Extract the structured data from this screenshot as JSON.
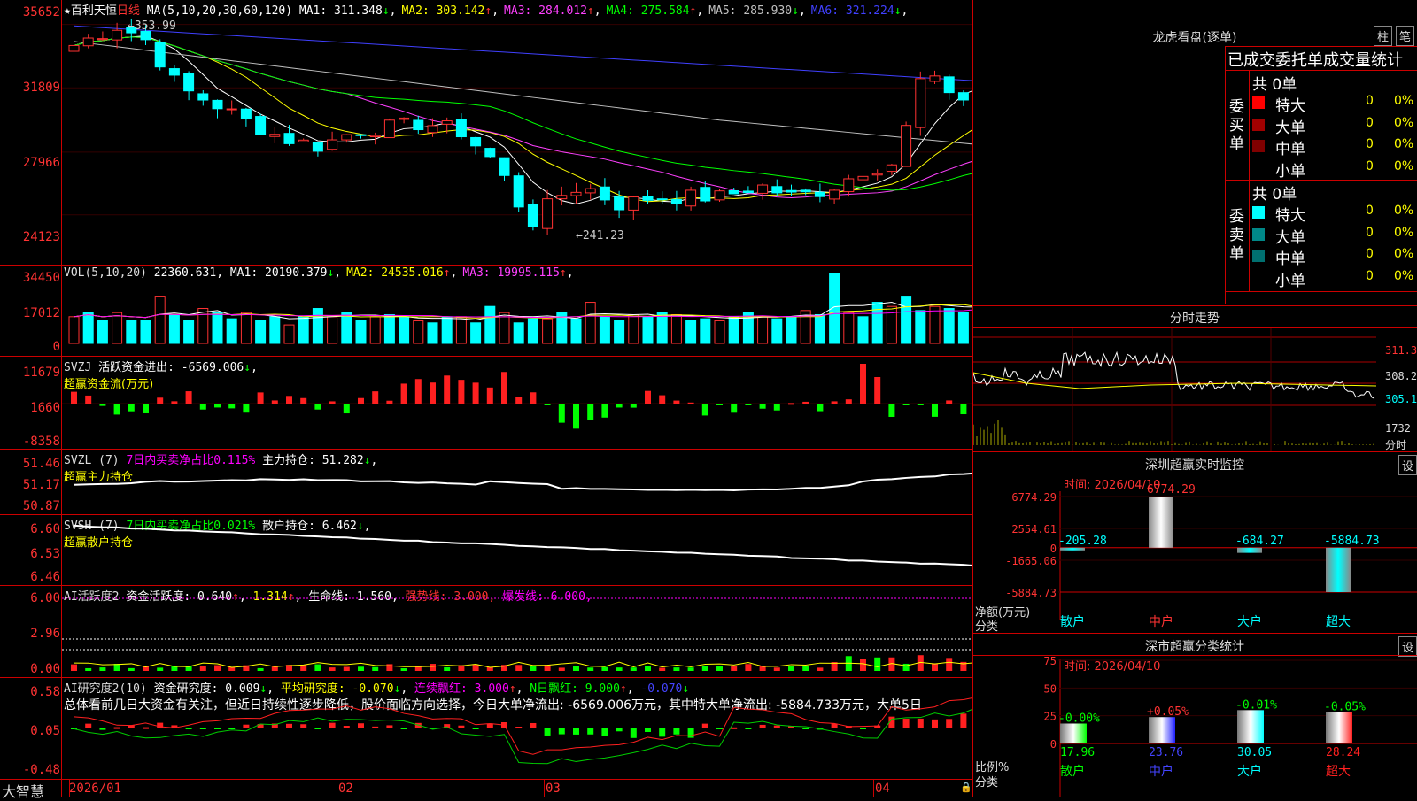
{
  "stock_name": "百利天恒",
  "period": "日线",
  "price": {
    "ma_header": "MA(5,10,20,30,60,120)",
    "ma": [
      {
        "label": "MA1:",
        "value": "311.348",
        "arrow": "↓",
        "color": "#ffffff"
      },
      {
        "label": "MA2:",
        "value": "303.142",
        "arrow": "↑",
        "color": "#ffff00"
      },
      {
        "label": "MA3:",
        "value": "284.012",
        "arrow": "↑",
        "color": "#ff40ff"
      },
      {
        "label": "MA4:",
        "value": "275.584",
        "arrow": "↑",
        "color": "#00ff00"
      },
      {
        "label": "MA5:",
        "value": "285.930",
        "arrow": "↓",
        "color": "#c0c0c0"
      },
      {
        "label": "MA6:",
        "value": "321.224",
        "arrow": "↓",
        "color": "#4040ff"
      }
    ],
    "yticks": [
      "35652",
      "31809",
      "27966",
      "24123"
    ],
    "high_label": "353.99",
    "low_label": "241.23"
  },
  "vol": {
    "label": "VOL(5,10,20)",
    "value": "22360.631",
    "ma": [
      {
        "label": "MA1:",
        "value": "20190.379",
        "arrow": "↓",
        "color": "#ffffff"
      },
      {
        "label": "MA2:",
        "value": "24535.016",
        "arrow": "↑",
        "color": "#ffff00"
      },
      {
        "label": "MA3:",
        "value": "19995.115",
        "arrow": "↑",
        "color": "#ff40ff"
      }
    ],
    "yticks": [
      "34450",
      "17012",
      "0"
    ]
  },
  "svzj": {
    "label": "SVZJ",
    "name": "活跃资金进出:",
    "value": "-6569.006",
    "arrow": "↓",
    "line2": "超赢资金流(万元)",
    "yticks": [
      "11679",
      "1660",
      "-8358"
    ]
  },
  "svzl": {
    "label": "SVZL (7)",
    "ratio": "7日内买卖净占比0.115%",
    "name": "主力持仓:",
    "value": "51.282",
    "arrow": "↓",
    "line2": "超赢主力持仓",
    "yticks": [
      "51.46",
      "51.17",
      "50.87"
    ]
  },
  "svsh": {
    "label": "SVSH (7)",
    "ratio": "7日内买卖净占比0.021%",
    "name": "散户持仓:",
    "value": "6.462",
    "arrow": "↓",
    "line2": "超赢散户持仓",
    "yticks": [
      "6.60",
      "6.53",
      "6.46"
    ]
  },
  "ai1": {
    "label": "AI活跃度2",
    "name": "资金活跃度:",
    "v1": "0.640",
    "v2": "1.314",
    "life": "生命线: 1.560,",
    "strong": "强势线: 3.000,",
    "burst": "爆发线: 6.000,",
    "yticks": [
      "6.00",
      "2.96",
      "0.00"
    ]
  },
  "ai2": {
    "label": "AI研究度2(10)",
    "name": "资金研究度:",
    "v1": "0.009",
    "avg": "平均研究度: -0.070",
    "red": "连续飘红: 3.000",
    "nred": "N日飘红: 9.000",
    "last": "-0.070",
    "summary": "总体看前几日大资金有关注，但近日持续性逐步降低，股价面临方向选择，今日大单净流出: -6569.006万元，其中特大单净流出: -5884.733万元，大单5日",
    "yticks": [
      "0.58",
      "0.05",
      "-0.48"
    ]
  },
  "xaxis": [
    "2026/01",
    "02",
    "03",
    "04"
  ],
  "brand": "大智慧",
  "right": {
    "longhu_title": "龙虎看盘(逐单)",
    "btn_zhu": "柱",
    "btn_bi": "笔",
    "stat_title": "已成交委托单成交量统计",
    "buy_label": "委买单",
    "sell_label": "委卖单",
    "buy_total": "共 0单",
    "sell_total": "共 0单",
    "buy_rows": [
      {
        "name": "特大",
        "count": "0",
        "pct": "0%",
        "color": "#ff0000"
      },
      {
        "name": "大单",
        "count": "0",
        "pct": "0%",
        "color": "#a00000"
      },
      {
        "name": "中单",
        "count": "0",
        "pct": "0%",
        "color": "#800000"
      },
      {
        "name": "小单",
        "count": "0",
        "pct": "0%",
        "color": "#000000"
      }
    ],
    "sell_rows": [
      {
        "name": "特大",
        "count": "0",
        "pct": "0%",
        "color": "#00ffff"
      },
      {
        "name": "大单",
        "count": "0",
        "pct": "0%",
        "color": "#008888"
      },
      {
        "name": "中单",
        "count": "0",
        "pct": "0%",
        "color": "#007070"
      },
      {
        "name": "小单",
        "count": "0",
        "pct": "0%",
        "color": "#000000"
      }
    ],
    "intraday_title": "分时走势",
    "intraday_ticks": [
      "311.3",
      "308.2",
      "305.1",
      "1732",
      "分时"
    ],
    "monitor_title": "深圳超赢实时监控",
    "monitor_btn": "设",
    "monitor_time": "时间: 2026/04/10",
    "monitor_yticks": [
      "6774.29",
      "2554.61",
      "0",
      "-1665.06",
      "-5884.73"
    ],
    "monitor_ylabel": "净额(万元)",
    "monitor_xlabel": "分类",
    "class_title": "深市超赢分类统计",
    "class_btn": "设",
    "class_time": "时间: 2026/04/10",
    "class_yticks": [
      "75",
      "50",
      "25",
      "0"
    ],
    "class_ylabel": "比例%",
    "class_xlabel": "分类"
  },
  "chart_data": [
    {
      "type": "bar",
      "title": "深圳超赢实时监控",
      "categories": [
        "散户",
        "中户",
        "大户",
        "超大"
      ],
      "values": [
        -205.28,
        6774.29,
        -684.27,
        -5884.73
      ],
      "labels": [
        "-205.28",
        "6774.29",
        "-684.27",
        "-5884.73"
      ],
      "ylim": [
        -5884.73,
        6774.29
      ],
      "ylabel": "净额(万元)",
      "xlabel": "分类"
    },
    {
      "type": "bar",
      "title": "深市超赢分类统计",
      "categories": [
        "散户",
        "中户",
        "大户",
        "超大"
      ],
      "values": [
        17.96,
        23.76,
        30.05,
        28.24
      ],
      "labels": [
        "17.96",
        "23.76",
        "30.05",
        "28.24"
      ],
      "changes": [
        "-0.00%",
        "+0.05%",
        "-0.01%",
        "-0.05%"
      ],
      "colors": [
        "#00ff00",
        "#2020ff",
        "#00ffff",
        "#ff2020"
      ],
      "ylim": [
        0,
        75
      ],
      "ylabel": "比例%",
      "xlabel": "分类"
    },
    {
      "type": "bar",
      "title": "VOL(5,10,20)",
      "values": [
        13000,
        15000,
        11000,
        15000,
        11000,
        11000,
        23000,
        14000,
        11000,
        17000,
        15000,
        12000,
        15000,
        11000,
        13000,
        9000,
        13000,
        17000,
        13000,
        15000,
        11000,
        13000,
        14000,
        13000,
        11000,
        10000,
        13000,
        13000,
        10000,
        18000,
        15000,
        10000,
        12000,
        12000,
        15000,
        12000,
        20000,
        13000,
        11000,
        14000,
        13000,
        15000,
        14000,
        11000,
        12000,
        11000,
        13000,
        15000,
        13000,
        12000,
        13000,
        16000,
        14000,
        34000,
        15000,
        13000,
        20000,
        18000,
        23000,
        16000,
        18000,
        17000,
        15000,
        22360
      ],
      "ylim": [
        0,
        34450
      ]
    }
  ]
}
